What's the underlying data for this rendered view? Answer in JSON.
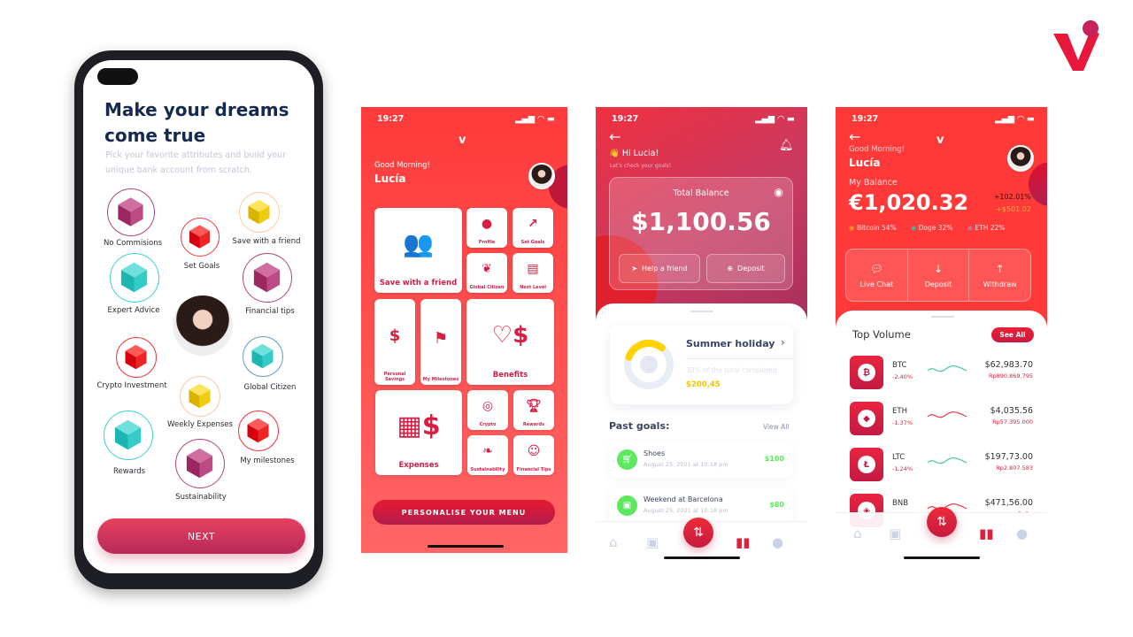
{
  "brand": {
    "logo_letter": "V",
    "accent": "#e8183c"
  },
  "onboarding": {
    "title": "Make your dreams come true",
    "subtitle": "Pick your favorite attributes and build your unique bank account from scratch.",
    "attributes": [
      "No Commisions",
      "Set Goals",
      "Save with a friend",
      "Expert Advice",
      "Financial tips",
      "Crypto Investment",
      "Global Citizen",
      "Weekly Expenses",
      "Rewards",
      "My milestones",
      "Sustainability"
    ],
    "next_label": "NEXT"
  },
  "menu_screen": {
    "time": "19:27",
    "greeting": "Good Morning!",
    "name": "Lucía",
    "tiles": [
      "Save with a friend",
      "Profile",
      "Set Goals",
      "Global Citizen",
      "Next Level",
      "Personal Savings",
      "My Milestones",
      "Benefits",
      "Expenses",
      "Crypto",
      "Rewards",
      "Sustainability",
      "Financial Tips"
    ],
    "cta": "PERSONALISE YOUR MENU"
  },
  "goals_screen": {
    "time": "19:27",
    "greeting": "Hi Lucia!",
    "subgreeting": "Let's check your goals!",
    "balance_label": "Total Balance",
    "balance": "$1,100.56",
    "help_label": "Help a friend",
    "deposit_label": "Deposit",
    "goal": {
      "title": "Summer holiday",
      "progress_text": "30% of the total completed",
      "amount": "$200,45",
      "progress": 0.3
    },
    "past_title": "Past goals:",
    "view_all": "View All",
    "past": [
      {
        "name": "Shoes",
        "date": "August 25, 2021 at 10:18 pm",
        "amount": "$100",
        "icon": "cart-icon"
      },
      {
        "name": "Weekend at Barcelona",
        "date": "August 25, 2021 at 10:18 pm",
        "amount": "$80",
        "icon": "bus-icon"
      }
    ]
  },
  "crypto_screen": {
    "time": "19:27",
    "greeting": "Good Morning!",
    "name": "Lucía",
    "balance_label": "My Balance",
    "balance": "€1,020.32",
    "change_pct": "+102.01%",
    "change_amt": "+$501.02",
    "allocations": [
      {
        "label": "Bitcoin 54%",
        "color": "#f5a623"
      },
      {
        "label": "Doge 32%",
        "color": "#3bbfa8"
      },
      {
        "label": "ETH 22%",
        "color": "#c27aa0"
      }
    ],
    "actions": [
      "Live Chat",
      "Deposit",
      "Withdraw"
    ],
    "top_title": "Top Volume",
    "see_all": "See All",
    "coins": [
      {
        "sym": "BTC",
        "pct": "-2.40%",
        "usd": "$62,983.70",
        "idr": "Rp890.869.795",
        "glyph": "₿",
        "trend": "#4cc9a0"
      },
      {
        "sym": "ETH",
        "pct": "-1.37%",
        "usd": "$4,035.56",
        "idr": "Rp57.395.000",
        "glyph": "◆",
        "trend": "#e8404f"
      },
      {
        "sym": "LTC",
        "pct": "-1.24%",
        "usd": "$197,73.00",
        "idr": "Rp2.807.583",
        "glyph": "Ł",
        "trend": "#4cc9a0"
      },
      {
        "sym": "BNB",
        "pct": "",
        "usd": "$471,56.00",
        "idr": "RpRp",
        "glyph": "◈",
        "trend": "#e8404f"
      }
    ]
  }
}
